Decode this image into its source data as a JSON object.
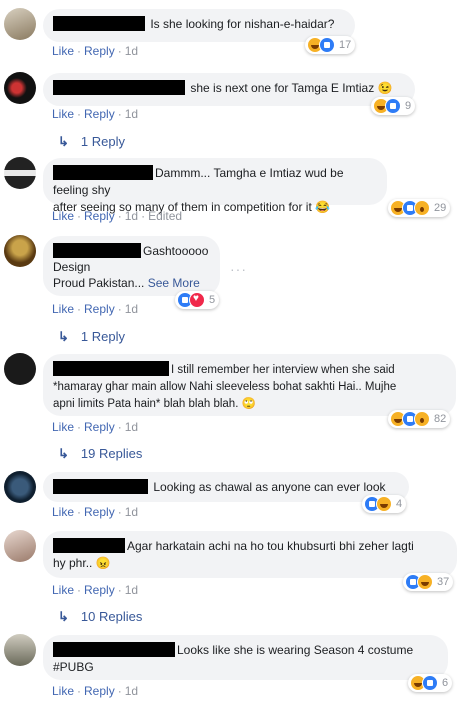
{
  "actions": {
    "like": "Like",
    "reply": "Reply",
    "edited": "Edited"
  },
  "comments": [
    {
      "text": "Is she looking for nishan-e-haidar?",
      "time": "1d",
      "reactions": [
        "haha",
        "like"
      ],
      "count": "17"
    },
    {
      "text": "she is next one for Tamga E Imtiaz 😉",
      "time": "1d",
      "reactions": [
        "haha",
        "like"
      ],
      "count": "9",
      "replies": "1 Reply"
    },
    {
      "text_line1": "Dammm... Tamgha e Imtiaz wud be feeling shy",
      "text_line2": "after seeing so many of them in competition for it 😂",
      "time": "1d",
      "edited": true,
      "reactions": [
        "haha",
        "like",
        "wow"
      ],
      "count": "29"
    },
    {
      "text_line1": "Gashtooooo",
      "text_line2": "Design",
      "text_line3": "Proud Pakistan...",
      "see_more": "See More",
      "time": "1d",
      "reactions": [
        "like",
        "love"
      ],
      "count": "5",
      "replies": "1 Reply"
    },
    {
      "text_line1": "I still remember her interview when she said",
      "text_line2": "*hamaray ghar main allow Nahi sleeveless bohat sakhti Hai.. Mujhe",
      "text_line3": "apni limits Pata hain* blah blah blah. 🙄",
      "time": "1d",
      "reactions": [
        "haha",
        "like",
        "wow"
      ],
      "count": "82",
      "replies": "19 Replies"
    },
    {
      "text": "Looking as chawal as anyone can ever look",
      "time": "1d",
      "reactions": [
        "like",
        "haha"
      ],
      "count": "4"
    },
    {
      "text_line1": "Agar harkatain achi na ho tou khubsurti bhi zeher lagti",
      "text_line2": "hy phr.. 😠",
      "time": "1d",
      "reactions": [
        "like",
        "haha"
      ],
      "count": "37",
      "replies": "10 Replies"
    },
    {
      "text_line1": "Looks like she is wearing Season 4 costume",
      "text_line2": "#PUBG",
      "time": "1d",
      "reactions": [
        "haha",
        "like"
      ],
      "count": "6"
    }
  ],
  "colors": {
    "link": "#4267b2",
    "bubble": "#f2f3f5",
    "meta": "#90949c"
  }
}
